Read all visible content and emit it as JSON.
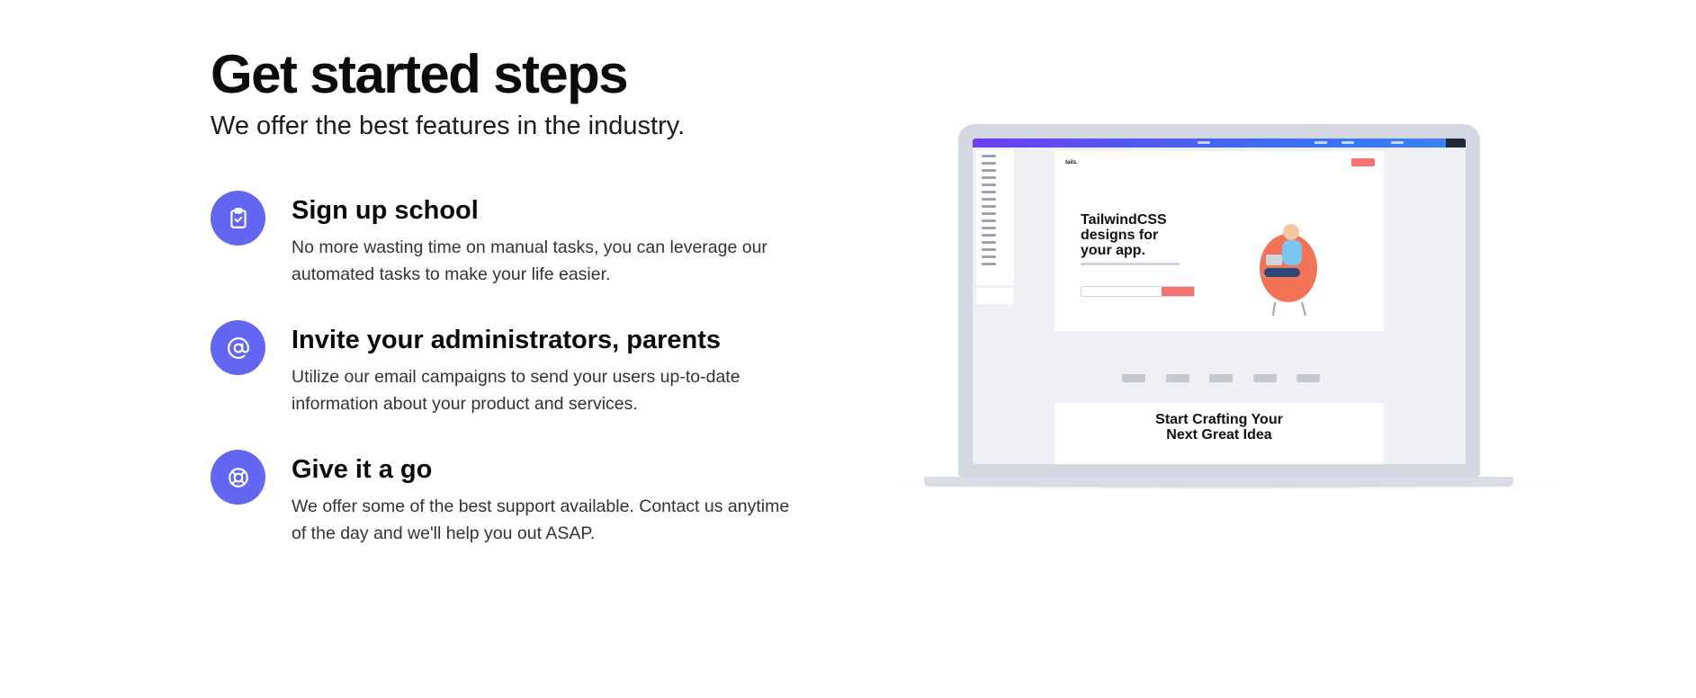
{
  "header": {
    "title": "Get started steps",
    "subtitle": "We offer the best features in the industry."
  },
  "steps": [
    {
      "title": "Sign up school",
      "description": "No more wasting time on manual tasks, you can leverage our automated tasks to make your life easier.",
      "icon": "clipboard-check-icon"
    },
    {
      "title": "Invite your administrators, parents",
      "description": "Utilize our email campaigns to send your users up-to-date information about your product and services.",
      "icon": "at-sign-icon"
    },
    {
      "title": "Give it a go",
      "description": "We offer some of the best support available. Contact us anytime of the day and we'll help you out ASAP.",
      "icon": "lifebuoy-icon"
    }
  ],
  "mockup": {
    "hero_title": "TailwindCSS designs for your app.",
    "section_title": "Start Crafting Your Next Great Idea",
    "logo": "tails."
  },
  "colors": {
    "accent": "#6366f1",
    "mockup_button": "#f87171"
  }
}
